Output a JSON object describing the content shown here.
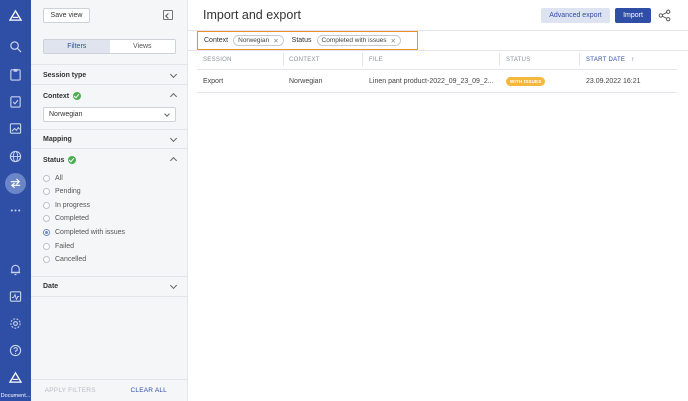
{
  "rail": {
    "items": [
      "logo-icon",
      "search-icon",
      "clipboard-icon",
      "checklist-icon",
      "image-icon",
      "globe-icon",
      "import-export-icon",
      "more-icon",
      "bell-icon",
      "activity-icon",
      "gear-icon",
      "help-icon",
      "logo-bottom-icon"
    ],
    "footer_label": "Document..."
  },
  "panel": {
    "save_view_label": "Save view",
    "tabs": [
      "Filters",
      "Views"
    ],
    "sections": {
      "session_type": "Session type",
      "context": "Context",
      "mapping": "Mapping",
      "status": "Status",
      "date": "Date"
    },
    "context_value": "Norwegian",
    "status_options": [
      "All",
      "Pending",
      "In progress",
      "Completed",
      "Completed with issues",
      "Failed",
      "Cancelled"
    ],
    "status_selected": "Completed with issues",
    "apply_label": "APPLY FILTERS",
    "clear_label": "CLEAR ALL"
  },
  "main": {
    "title": "Import and export",
    "advanced_export_label": "Advanced export",
    "import_label": "Import",
    "active_filters": {
      "context_label": "Context",
      "context_chip": "Norwegian",
      "status_label": "Status",
      "status_chip": "Completed with issues"
    },
    "table": {
      "headers": [
        "SESSION",
        "CONTEXT",
        "FILE",
        "STATUS",
        "START DATE"
      ],
      "sort_arrow": "↑",
      "rows": [
        {
          "session": "Export",
          "context": "Norwegian",
          "file": "Linen pant product-2022_09_23_09_2...",
          "status": "WITH ISSUES",
          "start_date": "23.09.2022 16:21"
        }
      ]
    }
  },
  "colors": {
    "rail_bg": "#2f4fa6",
    "accent": "#2f4fa6",
    "highlight_border": "#e8912d",
    "badge": "#f4b83e",
    "ok": "#4caf50"
  }
}
